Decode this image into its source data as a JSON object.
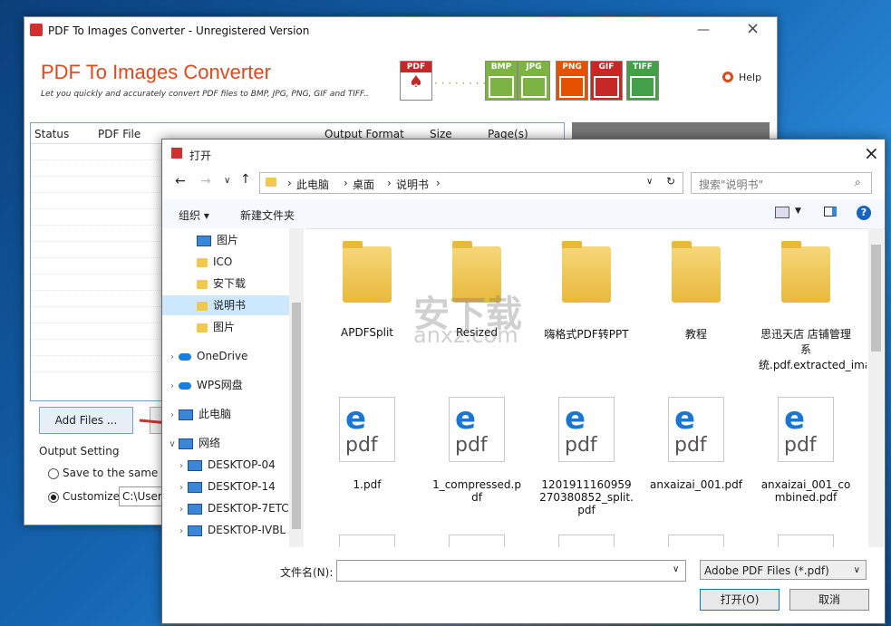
{
  "main": {
    "title": "PDF To Images Converter - Unregistered Version",
    "heading": "PDF To Images Converter",
    "subtitle": "Let you quickly and accurately convert PDF files to  BMP, JPG, PNG, GIF and TIFF..",
    "source_format": "PDF",
    "formats": [
      {
        "label": "BMP",
        "color": "#7cb342"
      },
      {
        "label": "JPG",
        "color": "#7cb342"
      },
      {
        "label": "PNG",
        "color": "#e65100"
      },
      {
        "label": "GIF",
        "color": "#c62828"
      },
      {
        "label": "TIFF",
        "color": "#43a047"
      }
    ],
    "help": "Help",
    "columns": [
      "Status",
      "PDF File",
      "Output Format",
      "Size",
      "Page(s)"
    ],
    "add_files": "Add Files ...",
    "output_setting": "Output Setting",
    "save_same": "Save to the same fo",
    "customize": "Customize",
    "customize_path": "C:\\Users"
  },
  "dialog": {
    "title": "打开",
    "close": "×",
    "breadcrumb": [
      "此电脑",
      "桌面",
      "说明书"
    ],
    "search_placeholder": "搜索\"说明书\"",
    "organize": "组织 ▾",
    "new_folder": "新建文件夹",
    "nav": [
      {
        "label": "图片",
        "type": "pic"
      },
      {
        "label": "ICO",
        "type": "folder"
      },
      {
        "label": "安下载",
        "type": "folder"
      },
      {
        "label": "说明书",
        "type": "folder",
        "selected": true
      },
      {
        "label": "图片",
        "type": "folder"
      },
      {
        "label": "OneDrive",
        "type": "cloud"
      },
      {
        "label": "WPS网盘",
        "type": "cloud"
      },
      {
        "label": "此电脑",
        "type": "pc"
      },
      {
        "label": "网络",
        "type": "pc",
        "expanded": true
      },
      {
        "label": "DESKTOP-04",
        "type": "pc"
      },
      {
        "label": "DESKTOP-14",
        "type": "pc"
      },
      {
        "label": "DESKTOP-7ETC",
        "type": "pc"
      },
      {
        "label": "DESKTOP-IVBL",
        "type": "pc"
      }
    ],
    "folders": [
      "APDFSplit",
      "Resized",
      "嗨格式PDF转PPT",
      "教程",
      "思迅天店 店铺管理系统.pdf.extracted_images"
    ],
    "pdfs": [
      "1.pdf",
      "1_compressed.pdf",
      "1201911160959270380852_split.pdf",
      "anxaizai_001.pdf",
      "anxaizai_001_combined.pdf"
    ],
    "filename_label": "文件名(N):",
    "filetype": "Adobe PDF Files (*.pdf)",
    "open": "打开(O)",
    "cancel": "取消"
  },
  "watermark": {
    "line1": "安下载",
    "line2": "anxz.com"
  }
}
